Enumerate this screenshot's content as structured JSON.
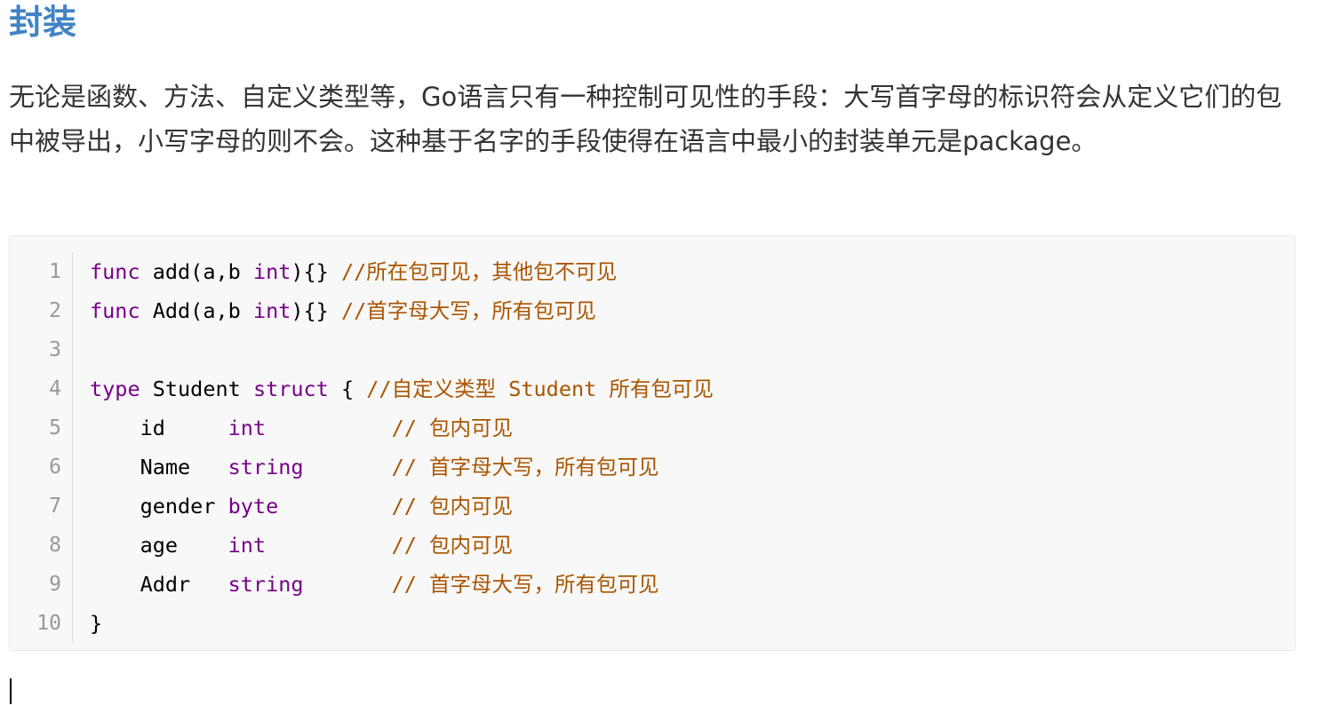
{
  "heading": "封装",
  "paragraph": "无论是函数、方法、自定义类型等，Go语言只有一种控制可见性的手段：大写首字母的标识符会从定义它们的包中被导出，小写字母的则不会。这种基于名字的手段使得在语言中最小的封装单元是package。",
  "code": {
    "line_numbers": [
      "1",
      "2",
      "3",
      "4",
      "5",
      "6",
      "7",
      "8",
      "9",
      "10"
    ],
    "lines": [
      [
        {
          "cls": "kw",
          "text": "func"
        },
        {
          "cls": "tx",
          "text": " add(a,b "
        },
        {
          "cls": "ty",
          "text": "int"
        },
        {
          "cls": "tx",
          "text": "){} "
        },
        {
          "cls": "cm",
          "text": "//所在包可见，其他包不可见"
        }
      ],
      [
        {
          "cls": "kw",
          "text": "func"
        },
        {
          "cls": "tx",
          "text": " Add(a,b "
        },
        {
          "cls": "ty",
          "text": "int"
        },
        {
          "cls": "tx",
          "text": "){} "
        },
        {
          "cls": "cm",
          "text": "//首字母大写，所有包可见"
        }
      ],
      [],
      [
        {
          "cls": "kw",
          "text": "type"
        },
        {
          "cls": "tx",
          "text": " Student "
        },
        {
          "cls": "kw",
          "text": "struct"
        },
        {
          "cls": "tx",
          "text": " { "
        },
        {
          "cls": "cm",
          "text": "//自定义类型 Student 所有包可见"
        }
      ],
      [
        {
          "cls": "tx",
          "text": "    id     "
        },
        {
          "cls": "ty",
          "text": "int"
        },
        {
          "cls": "tx",
          "text": "          "
        },
        {
          "cls": "cm",
          "text": "// 包内可见"
        }
      ],
      [
        {
          "cls": "tx",
          "text": "    Name   "
        },
        {
          "cls": "ty",
          "text": "string"
        },
        {
          "cls": "tx",
          "text": "       "
        },
        {
          "cls": "cm",
          "text": "// 首字母大写，所有包可见"
        }
      ],
      [
        {
          "cls": "tx",
          "text": "    gender "
        },
        {
          "cls": "ty",
          "text": "byte"
        },
        {
          "cls": "tx",
          "text": "         "
        },
        {
          "cls": "cm",
          "text": "// 包内可见"
        }
      ],
      [
        {
          "cls": "tx",
          "text": "    age    "
        },
        {
          "cls": "ty",
          "text": "int"
        },
        {
          "cls": "tx",
          "text": "          "
        },
        {
          "cls": "cm",
          "text": "// 包内可见"
        }
      ],
      [
        {
          "cls": "tx",
          "text": "    Addr   "
        },
        {
          "cls": "ty",
          "text": "string"
        },
        {
          "cls": "tx",
          "text": "       "
        },
        {
          "cls": "cm",
          "text": "// 首字母大写，所有包可见"
        }
      ],
      [
        {
          "cls": "tx",
          "text": "}"
        }
      ]
    ]
  },
  "colors": {
    "heading": "#4183c4",
    "keyword": "#770088",
    "comment": "#aa5500",
    "code_background": "#f8f8f8"
  }
}
